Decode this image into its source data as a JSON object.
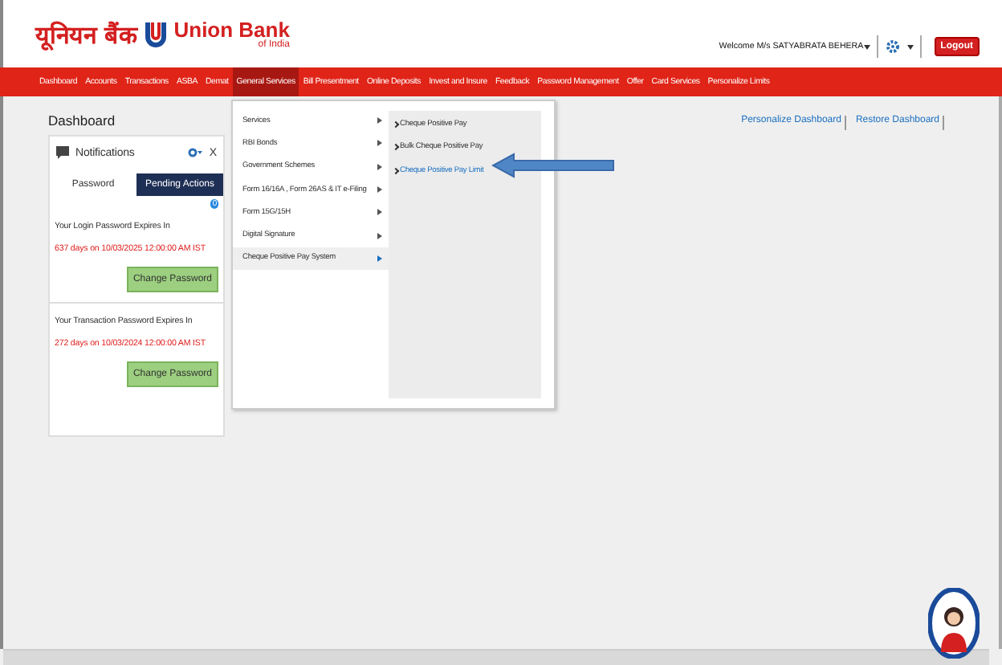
{
  "logo": {
    "hindi": "यूनियन बैंक",
    "name": "Union Bank",
    "sub": "of India"
  },
  "header": {
    "welcome": "Welcome M/s SATYABRATA BEHERA",
    "logout": "Logout"
  },
  "nav": [
    {
      "label": "Dashboard",
      "selected": false
    },
    {
      "label": "Accounts",
      "selected": false
    },
    {
      "label": "Transactions",
      "selected": false
    },
    {
      "label": "ASBA",
      "selected": false
    },
    {
      "label": "Demat",
      "selected": false
    },
    {
      "label": "General Services",
      "selected": true
    },
    {
      "label": "Bill Presentment",
      "selected": false
    },
    {
      "label": "Online Deposits",
      "selected": false
    },
    {
      "label": "Invest and Insure",
      "selected": false
    },
    {
      "label": "Feedback",
      "selected": false
    },
    {
      "label": "Password Management",
      "selected": false
    },
    {
      "label": "Offer",
      "selected": false
    },
    {
      "label": "Card Services",
      "selected": false
    },
    {
      "label": "Personalize Limits",
      "selected": false
    }
  ],
  "page_title": "Dashboard",
  "dashboard_links": [
    "Personalize Dashboard",
    "Restore Dashboard"
  ],
  "notifications": {
    "title": "Notifications",
    "close": "X",
    "badge": "0",
    "tabs": [
      {
        "label": "Password",
        "selected": false
      },
      {
        "label": "Pending Actions",
        "selected": true
      }
    ],
    "items": [
      {
        "text": "Your Login Password Expires In",
        "detail": "637 days on 10/03/2025 12:00:00 AM IST",
        "button": "Change Password"
      },
      {
        "text": "Your Transaction Password Expires In",
        "detail": "272 days on 10/03/2024 12:00:00 AM IST",
        "button": "Change Password"
      }
    ]
  },
  "menu": {
    "items": [
      {
        "label": "Services",
        "selected": false
      },
      {
        "label": "RBI Bonds",
        "selected": false
      },
      {
        "label": "Government Schemes",
        "selected": false
      },
      {
        "label": "Form 16/16A , Form 26AS & IT e-Filing",
        "selected": false
      },
      {
        "label": "Form 15G/15H",
        "selected": false
      },
      {
        "label": "Digital Signature",
        "selected": false
      },
      {
        "label": "Cheque Positive Pay System",
        "selected": true
      }
    ],
    "submenu": [
      {
        "label": "Cheque Positive Pay",
        "selected": false
      },
      {
        "label": "Bulk Cheque Positive Pay",
        "selected": false
      },
      {
        "label": "Cheque Positive Pay Limit",
        "selected": true
      }
    ]
  }
}
